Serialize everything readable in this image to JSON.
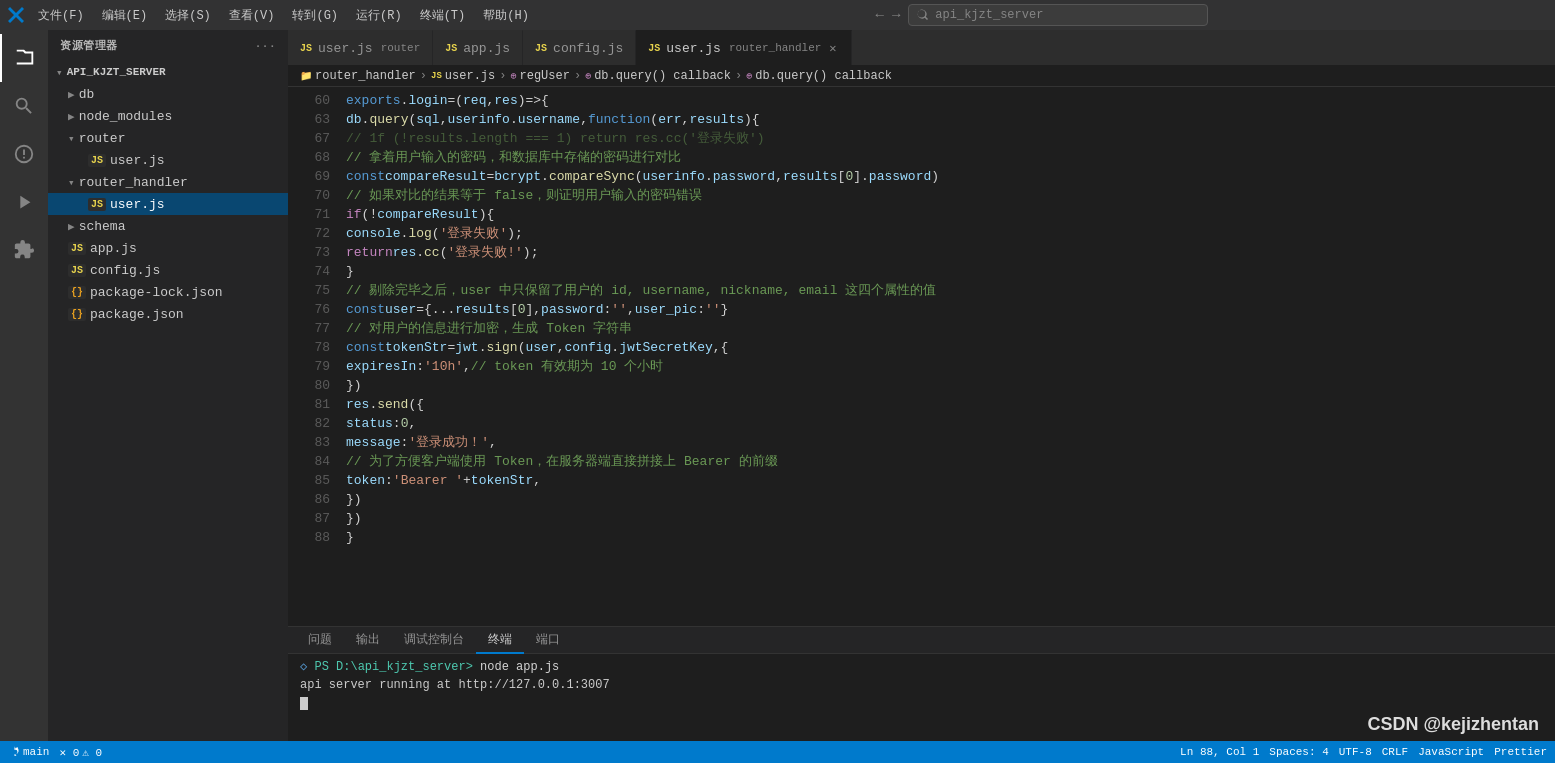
{
  "titleBar": {
    "menus": [
      "文件(F)",
      "编辑(E)",
      "选择(S)",
      "查看(V)",
      "转到(G)",
      "运行(R)",
      "终端(T)",
      "帮助(H)"
    ],
    "searchPlaceholder": "api_kjzt_server"
  },
  "sidebar": {
    "header": "资源管理器",
    "project": "API_KJZT_SERVER",
    "tree": [
      {
        "id": "db",
        "type": "folder",
        "label": "db",
        "indent": 1,
        "collapsed": true
      },
      {
        "id": "node_modules",
        "type": "folder",
        "label": "node_modules",
        "indent": 1,
        "collapsed": true
      },
      {
        "id": "router",
        "type": "folder",
        "label": "router",
        "indent": 1,
        "collapsed": false
      },
      {
        "id": "router-user",
        "type": "js",
        "label": "user.js",
        "indent": 2
      },
      {
        "id": "router_handler",
        "type": "folder",
        "label": "router_handler",
        "indent": 1,
        "collapsed": false
      },
      {
        "id": "router_handler-user",
        "type": "js",
        "label": "user.js",
        "indent": 2,
        "active": true
      },
      {
        "id": "schema",
        "type": "folder",
        "label": "schema",
        "indent": 1,
        "collapsed": true
      },
      {
        "id": "app",
        "type": "js",
        "label": "app.js",
        "indent": 1
      },
      {
        "id": "config",
        "type": "js",
        "label": "config.js",
        "indent": 1
      },
      {
        "id": "package-lock",
        "type": "json",
        "label": "package-lock.json",
        "indent": 1
      },
      {
        "id": "package",
        "type": "json",
        "label": "package.json",
        "indent": 1
      }
    ]
  },
  "tabs": [
    {
      "id": "tab-user-router",
      "label": "user.js",
      "sublabel": "router",
      "type": "js",
      "active": false,
      "closable": false
    },
    {
      "id": "tab-app",
      "label": "app.js",
      "type": "js",
      "active": false,
      "closable": false
    },
    {
      "id": "tab-config",
      "label": "config.js",
      "type": "js",
      "active": false,
      "closable": false
    },
    {
      "id": "tab-user-handler",
      "label": "user.js",
      "sublabel": "router_handler",
      "type": "js",
      "active": true,
      "closable": true
    }
  ],
  "breadcrumb": [
    "router_handler",
    "user.js",
    "regUser",
    "db.query() callback",
    "db.query() callback"
  ],
  "codeLines": [
    {
      "num": 60,
      "html": "<span class='kw'>exports</span><span class='op'>.</span><span class='prop'>login</span> <span class='op'>=</span> <span class='punc'>(</span><span class='param'>req</span><span class='punc'>,</span> <span class='param'>res</span><span class='punc'>)</span> <span class='op'>=></span> <span class='punc'>{</span>"
    },
    {
      "num": 63,
      "html": "    <span class='var'>db</span><span class='op'>.</span><span class='fn'>query</span><span class='punc'>(</span><span class='var'>sql</span><span class='punc'>,</span> <span class='var'>userinfo</span><span class='op'>.</span><span class='prop'>username</span><span class='punc'>,</span> <span class='kw'>function</span> <span class='punc'>(</span><span class='param'>err</span><span class='punc'>,</span> <span class='param'>results</span><span class='punc'>)</span> <span class='punc'>{</span>"
    },
    {
      "num": 67,
      "html": "        <span class='comment'>// 1f (!results.length === 1) return res.cc('登录失败')</span>",
      "faded": true
    },
    {
      "num": 68,
      "html": "        <span class='comment'>// 拿着用户输入的密码，和数据库中存储的密码进行对比</span>"
    },
    {
      "num": 69,
      "html": "        <span class='kw'>const</span> <span class='var'>compareResult</span> <span class='op'>=</span> <span class='var'>bcrypt</span><span class='op'>.</span><span class='fn'>compareSync</span><span class='punc'>(</span><span class='var'>userinfo</span><span class='op'>.</span><span class='prop'>password</span><span class='punc'>,</span> <span class='var'>results</span><span class='punc'>[</span><span class='num'>0</span><span class='punc'>]</span><span class='op'>.</span><span class='prop'>password</span><span class='punc'>)</span>"
    },
    {
      "num": 70,
      "html": "        <span class='comment'>// 如果对比的结果等于 false，则证明用户输入的密码错误</span>"
    },
    {
      "num": 71,
      "html": "        <span class='kw2'>if</span> <span class='punc'>(</span><span class='op'>!</span><span class='var'>compareResult</span><span class='punc'>)</span> <span class='punc'>{</span>"
    },
    {
      "num": 72,
      "html": "            <span class='var'>console</span><span class='op'>.</span><span class='fn'>log</span><span class='punc'>(</span><span class='str'>'登录失败'</span><span class='punc'>);</span>"
    },
    {
      "num": 73,
      "html": "            <span class='kw2'>return</span> <span class='var'>res</span><span class='op'>.</span><span class='fn'>cc</span><span class='punc'>(</span><span class='str'>'登录失败!'</span><span class='punc'>);</span>"
    },
    {
      "num": 74,
      "html": "        <span class='punc'>}</span>"
    },
    {
      "num": 75,
      "html": "        <span class='comment'>// 剔除完毕之后，user 中只保留了用户的 id, username, nickname, email 这四个属性的值</span>"
    },
    {
      "num": 76,
      "html": "        <span class='kw'>const</span> <span class='var'>user</span> <span class='op'>=</span> <span class='punc'>{</span> <span class='op'>...</span><span class='var'>results</span><span class='punc'>[</span><span class='num'>0</span><span class='punc'>],</span> <span class='prop'>password</span><span class='op'>:</span> <span class='str'>''</span><span class='punc'>,</span> <span class='prop'>user_pic</span><span class='op'>:</span> <span class='str'>''</span> <span class='punc'>}</span>"
    },
    {
      "num": 77,
      "html": "        <span class='comment'>// 对用户的信息进行加密，生成 Token 字符串</span>"
    },
    {
      "num": 78,
      "html": "        <span class='kw'>const</span> <span class='var'>tokenStr</span> <span class='op'>=</span> <span class='var'>jwt</span><span class='op'>.</span><span class='fn'>sign</span><span class='punc'>(</span><span class='var'>user</span><span class='punc'>,</span> <span class='var'>config</span><span class='op'>.</span><span class='prop'>jwtSecretKey</span><span class='punc'>,</span> <span class='punc'>{</span>"
    },
    {
      "num": 79,
      "html": "            <span class='prop'>expiresIn</span><span class='op'>:</span> <span class='str'>'10h'</span><span class='punc'>,</span> <span class='comment'>// token 有效期为 10 个小时</span>"
    },
    {
      "num": 80,
      "html": "        <span class='punc'>})</span>"
    },
    {
      "num": 81,
      "html": "        <span class='var'>res</span><span class='op'>.</span><span class='fn'>send</span><span class='punc'>({</span>"
    },
    {
      "num": 82,
      "html": "            <span class='prop'>status</span><span class='op'>:</span> <span class='num'>0</span><span class='punc'>,</span>"
    },
    {
      "num": 83,
      "html": "            <span class='prop'>message</span><span class='op'>:</span> <span class='str'>'登录成功！'</span><span class='punc'>,</span>"
    },
    {
      "num": 84,
      "html": "            <span class='comment'>// 为了方便客户端使用 Token，在服务器端直接拼接上 Bearer 的前缀</span>"
    },
    {
      "num": 85,
      "html": "            <span class='prop'>token</span><span class='op'>:</span> <span class='str'>'Bearer '</span> <span class='op'>+</span> <span class='var'>tokenStr</span><span class='punc'>,</span>"
    },
    {
      "num": 86,
      "html": "        <span class='punc'>})"
    },
    {
      "num": 87,
      "html": "    <span class='punc'>})"
    },
    {
      "num": 88,
      "html": "<span class='punc'>}"
    }
  ],
  "panelTabs": [
    "问题",
    "输出",
    "调试控制台",
    "终端",
    "端口"
  ],
  "activePanelTab": "终端",
  "terminal": {
    "prompt": "PS D:\\api_kjzt_server>",
    "command": "node app.js",
    "output": "api server running at http://127.0.0.1:3007"
  },
  "watermark": "CSDN @kejizhentan",
  "statusBar": {
    "branch": "main",
    "errors": "0",
    "warnings": "0"
  }
}
